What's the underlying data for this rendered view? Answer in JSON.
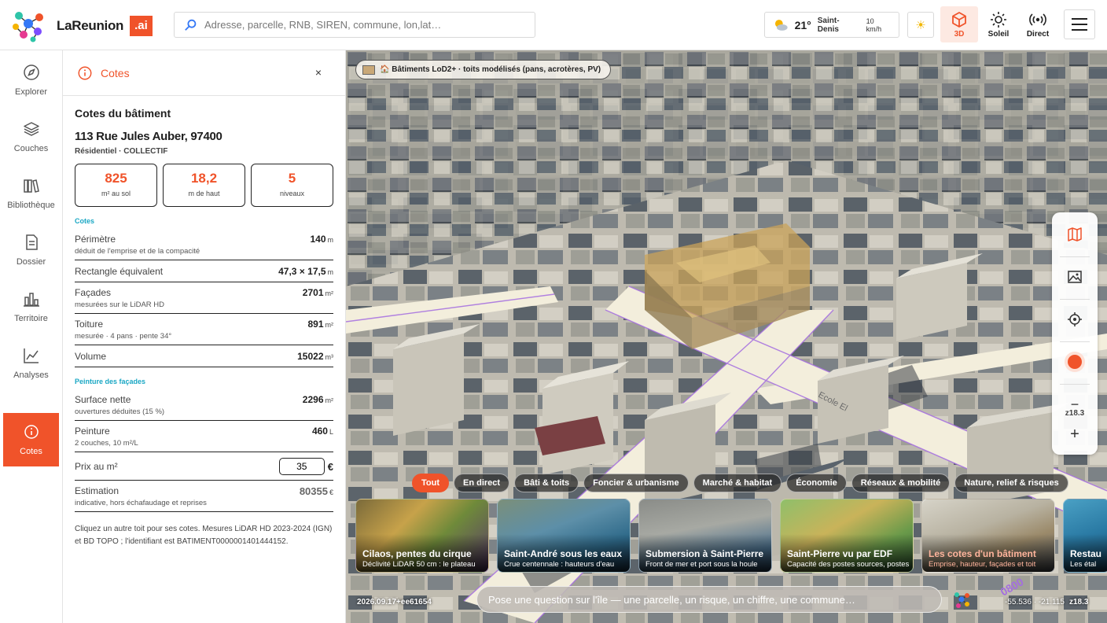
{
  "brand": {
    "name": "LaReunion",
    "suffix": ".ai"
  },
  "search": {
    "placeholder": "Adresse, parcelle, RNB, SIREN, commune, lon,lat…"
  },
  "weather": {
    "temp": "21°",
    "city": "Saint-Denis",
    "wind": "10 km/h",
    "icon": "partly-cloudy-icon"
  },
  "toolbar": {
    "sun_toggle_icon": "sun-icon",
    "btn_3d": "3D",
    "btn_sun": "Soleil",
    "btn_live": "Direct"
  },
  "rail": {
    "items": [
      {
        "label": "Explorer",
        "icon": "compass-icon"
      },
      {
        "label": "Couches",
        "icon": "layers-icon"
      },
      {
        "label": "Bibliothèque",
        "icon": "library-icon"
      },
      {
        "label": "Dossier",
        "icon": "document-icon"
      },
      {
        "label": "Territoire",
        "icon": "bar-chart-icon"
      },
      {
        "label": "Analyses",
        "icon": "line-chart-icon"
      },
      {
        "label": "Cotes",
        "icon": "info-icon"
      }
    ]
  },
  "panel": {
    "title": "Cotes",
    "close": "×",
    "heading": "Cotes du bâtiment",
    "address": "113 Rue Jules Auber, 97400",
    "usage": "Résidentiel · COLLECTIF",
    "stats": [
      {
        "value": "825",
        "unit": "m² au sol"
      },
      {
        "value": "18,2",
        "unit": "m de haut"
      },
      {
        "value": "5",
        "unit": "niveaux"
      }
    ],
    "section_cotes": "Cotes",
    "perimetre": {
      "label": "Périmètre",
      "sub": "déduit de l'emprise et de la compacité",
      "value": "140",
      "unit": "m"
    },
    "rectangle": {
      "label": "Rectangle équivalent",
      "value": "47,3 × 17,5",
      "unit": "m"
    },
    "facades": {
      "label": "Façades",
      "sub": "mesurées sur le LiDAR HD",
      "value": "2701",
      "unit": "m²"
    },
    "toiture": {
      "label": "Toiture",
      "sub": "mesurée · 4 pans · pente 34°",
      "value": "891",
      "unit": "m²"
    },
    "volume": {
      "label": "Volume",
      "value": "15022",
      "unit": "m³"
    },
    "section_peinture": "Peinture des façades",
    "surface": {
      "label": "Surface nette",
      "sub": "ouvertures déduites (15 %)",
      "value": "2296",
      "unit": "m²"
    },
    "peinture": {
      "label": "Peinture",
      "sub": "2 couches, 10 m²/L",
      "value": "460",
      "unit": "L"
    },
    "prix": {
      "label": "Prix au m²",
      "value": "35",
      "currency": "€"
    },
    "estimation": {
      "label": "Estimation",
      "sub": "indicative, hors échafaudage et reprises",
      "value": "80355",
      "unit": "€"
    },
    "footnote": "Cliquez un autre toit pour ses cotes. Mesures LiDAR HD 2023-2024 (IGN) et BD TOPO ; l'identifiant est BATIMENT0000001401444152."
  },
  "map": {
    "layer_chip": "🏠 Bâtiments LoD2+ · toits modélisés (pans, acrotères, PV)",
    "controls": {
      "map_icon": "map-icon",
      "image_icon": "image-icon",
      "locate_icon": "crosshair-icon",
      "record_icon": "record-icon",
      "zoom_out": "−",
      "zoom_level": "z18.3",
      "zoom_in": "+"
    },
    "filters": [
      "Tout",
      "En direct",
      "Bâti & toits",
      "Foncier & urbanisme",
      "Marché & habitat",
      "Économie",
      "Réseaux & mobilité",
      "Nature, relief & risques"
    ],
    "cards": [
      {
        "title": "Cilaos, pentes du cirque",
        "sub": "Déclivité LiDAR 50 cm : le plateau"
      },
      {
        "title": "Saint-André sous les eaux",
        "sub": "Crue centennale : hauteurs d'eau"
      },
      {
        "title": "Submersion à Saint-Pierre",
        "sub": "Front de mer et port sous la houle"
      },
      {
        "title": "Saint-Pierre vu par EDF",
        "sub": "Capacité des postes sources, postes"
      },
      {
        "title": "Les cotes d'un bâtiment",
        "sub": "Emprise, hauteur, façades et toit"
      },
      {
        "title": "Restau",
        "sub": "Les étal"
      }
    ],
    "ask_placeholder": "Pose une question sur l'île — une parcelle, un risque, un chiffre, une commune…",
    "version": "2026.09.17+ee61654",
    "coords": "-55.536 · -21.115",
    "zoom": "z18.3",
    "street_labels": [
      "Ecole El",
      "0800"
    ]
  },
  "colors": {
    "accent": "#f0532a",
    "section": "#1aa7c4"
  }
}
